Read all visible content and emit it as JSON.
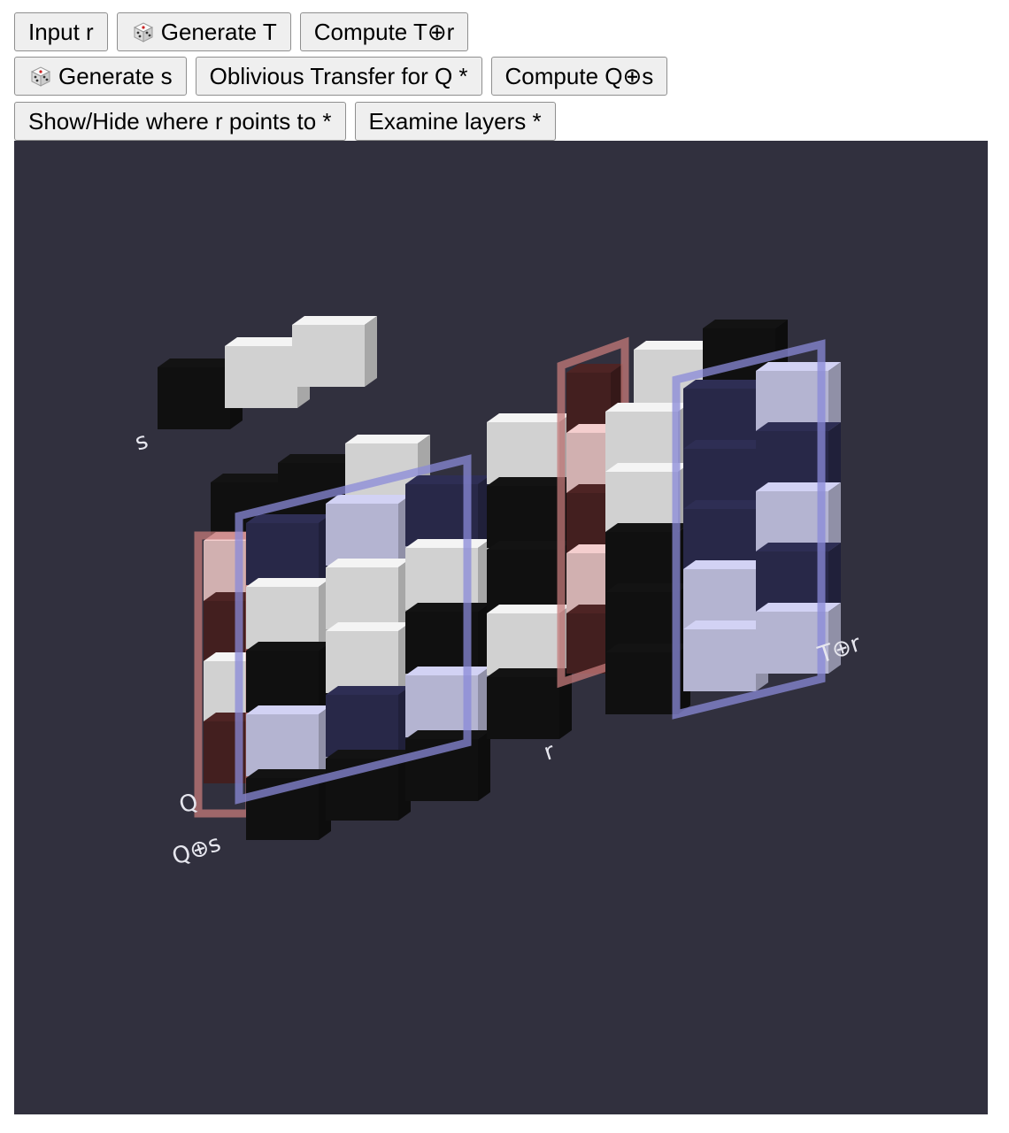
{
  "toolbar": {
    "input_r": "Input r",
    "generate_t": "Generate T",
    "compute_t_xor_r": "Compute T⊕r",
    "generate_s": "Generate s",
    "oblivious_transfer_q": "Oblivious Transfer for Q *",
    "compute_q_xor_s": "Compute Q⊕s",
    "show_hide_r": "Show/Hide where r points to *",
    "examine_layers": "Examine layers *",
    "dice_icon": "dice-icon"
  },
  "scene": {
    "labels": {
      "s": "s",
      "q": "Q",
      "q_xor_s": "Q⊕s",
      "r": "r",
      "t_xor_r": "T⊕r"
    },
    "colors": {
      "background": "#31303e",
      "white_cube": "#e8e8e8",
      "black_cube": "#121212",
      "light_blue_cube": "#c8c8e8",
      "dark_blue_cube": "#2c2c50",
      "pink_cube": "#e8c4c4",
      "dark_red_cube": "#4a2222",
      "blue_highlight": "#8a8ad8",
      "red_highlight": "#c47a7a"
    }
  }
}
